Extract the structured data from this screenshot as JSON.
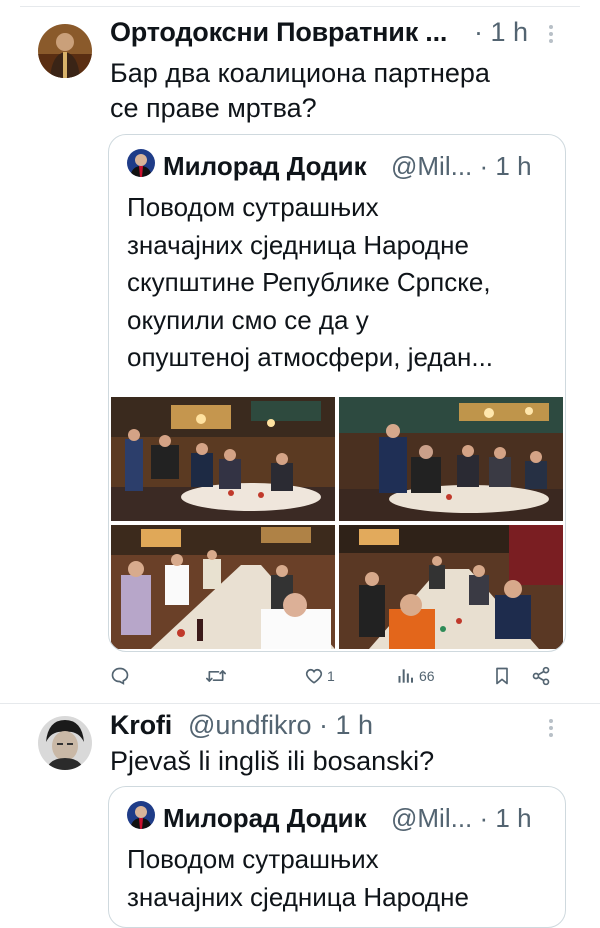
{
  "tweets": [
    {
      "name": "Ортодоксни Повратник ...",
      "meta": "· 1 h",
      "text": "Бар два коалициона партнера\nсе праве мртва?",
      "quote": {
        "name": "Милорад Додик",
        "meta": "@Mil... · 1 h",
        "text": "Поводом сутрашњих\nзначајних сједница Народне\nскупштине Републике Српске,\nокупили смо се да у\nопуштеној атмосфери, један..."
      },
      "stats": {
        "likes": "1",
        "views": "66"
      }
    },
    {
      "name": "Krofi",
      "meta": "@undfikro · 1 h",
      "text": "Pjevaš li ingliš ili bosanski?",
      "quote": {
        "name": "Милорад Додик",
        "meta": "@Mil... · 1 h",
        "text": "Поводом сутрашњих\nзначајних сједница Народне"
      }
    }
  ],
  "colors": {
    "text": "#0f1419",
    "secondary": "#536471",
    "border": "#cfd9de"
  },
  "icons": [
    "reply-icon",
    "retweet-icon",
    "like-icon",
    "views-icon",
    "bookmark-icon",
    "share-icon",
    "more-icon"
  ]
}
